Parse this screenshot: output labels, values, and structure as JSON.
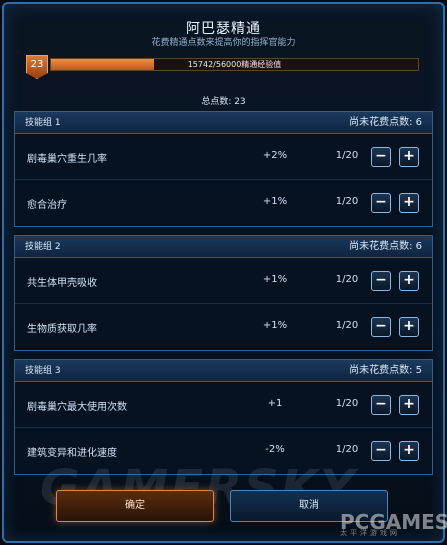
{
  "header": {
    "title": "阿巴瑟精通",
    "subtitle": "花费精通点数来提高你的指挥官能力"
  },
  "level": {
    "value": "23",
    "xp_text": "15742/56000精通经验值",
    "xp_progress": 0.281
  },
  "total_points": "总点数:  23",
  "groups": [
    {
      "title": "技能组 1",
      "remaining": "尚未花费点数:  6",
      "rows": [
        {
          "name": "剧毒巢穴重生几率",
          "bonus": "+2%",
          "count": "1/20"
        },
        {
          "name": "愈合治疗",
          "bonus": "+1%",
          "count": "1/20"
        }
      ]
    },
    {
      "title": "技能组 2",
      "remaining": "尚未花费点数:  6",
      "rows": [
        {
          "name": "共生体甲壳吸收",
          "bonus": "+1%",
          "count": "1/20"
        },
        {
          "name": "生物质获取几率",
          "bonus": "+1%",
          "count": "1/20"
        }
      ]
    },
    {
      "title": "技能组 3",
      "remaining": "尚未花费点数:  5",
      "rows": [
        {
          "name": "剧毒巢穴最大使用次数",
          "bonus": "+1",
          "count": "1/20"
        },
        {
          "name": "建筑变异和进化速度",
          "bonus": "-2%",
          "count": "1/20"
        }
      ]
    }
  ],
  "buttons": {
    "minus": "−",
    "plus": "+",
    "confirm": "确定",
    "cancel": "取消"
  },
  "watermarks": {
    "gamersky": "GAMERSKY",
    "pcgames": "PCGAMES",
    "pcgames_sub": "太平洋游戏网"
  },
  "colors": {
    "accent_orange": "#e07a2a",
    "frame_blue": "#2f6fa8"
  }
}
